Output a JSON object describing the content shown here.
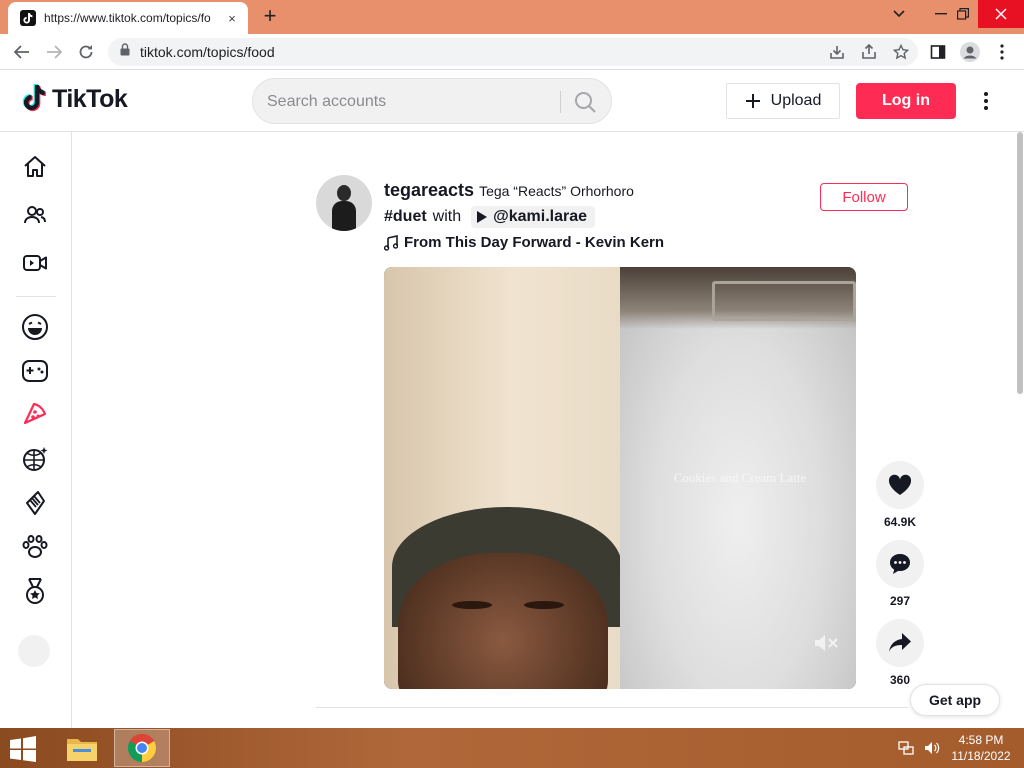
{
  "browser": {
    "tab_title": "https://www.tiktok.com/topics/fo",
    "tab_close": "×",
    "new_tab": "+",
    "url": "tiktok.com/topics/food"
  },
  "header": {
    "logo_text": "TikTok",
    "search_placeholder": "Search accounts",
    "upload_label": "Upload",
    "login_label": "Log in"
  },
  "sidebar": {
    "items": [
      "home-icon",
      "following-icon",
      "live-icon",
      "comedy-icon",
      "gaming-icon",
      "food-icon",
      "dance-icon",
      "beauty-icon",
      "animals-icon",
      "sports-icon"
    ],
    "active_item": "food-icon"
  },
  "post": {
    "author_handle": "tegareacts",
    "author_name": "Tega “Reacts” Orhorhoro",
    "hashtag": "#duet",
    "caption_with": "with",
    "mention": "@kami.larae",
    "music": "From This Day Forward - Kevin Kern",
    "follow_label": "Follow",
    "video_overlay_text": "Cookies and Cream Latte",
    "likes": "64.9K",
    "comments": "297",
    "shares": "360"
  },
  "get_app_label": "Get app",
  "taskbar": {
    "time": "4:58 PM",
    "date": "11/18/2022"
  },
  "colors": {
    "brand": "#fe2c55",
    "text": "#161823",
    "tab_strip": "#e7906b",
    "close_red": "#e81123"
  }
}
